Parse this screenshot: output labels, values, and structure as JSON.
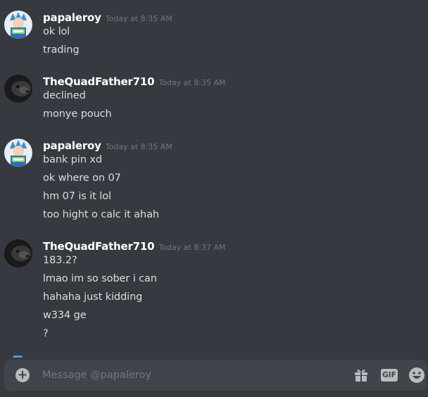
{
  "messages": [
    {
      "author": "papaleroy",
      "timestamp": "Today at 8:35 AM",
      "lines": [
        "ok lol",
        "trading"
      ]
    },
    {
      "author": "TheQuadFather710",
      "timestamp": "Today at 8:35 AM",
      "lines": [
        "declined",
        "monye pouch"
      ]
    },
    {
      "author": "papaleroy",
      "timestamp": "Today at 8:35 AM",
      "lines": [
        "bank pin xd",
        "ok where on 07",
        "hm 07 is it lol",
        "too hight o calc it ahah"
      ]
    },
    {
      "author": "TheQuadFather710",
      "timestamp": "Today at 8:37 AM",
      "lines": [
        "183.2?",
        "lmao im so sober i can",
        "hahaha just kidding",
        "w334 ge",
        "?"
      ]
    }
  ],
  "composer": {
    "placeholder": "Message @papaleroy",
    "gif_label": "GIF",
    "plus_label": "+"
  },
  "icons": {
    "attach": "plus-circle-icon",
    "gift": "gift-icon",
    "gif": "gif-icon",
    "emoji": "smiley-face-icon"
  },
  "colors": {
    "background": "#36393f",
    "composer": "#40444b",
    "username": "#ffffff",
    "timestamp": "#72767d",
    "message_text": "#dcddde"
  }
}
